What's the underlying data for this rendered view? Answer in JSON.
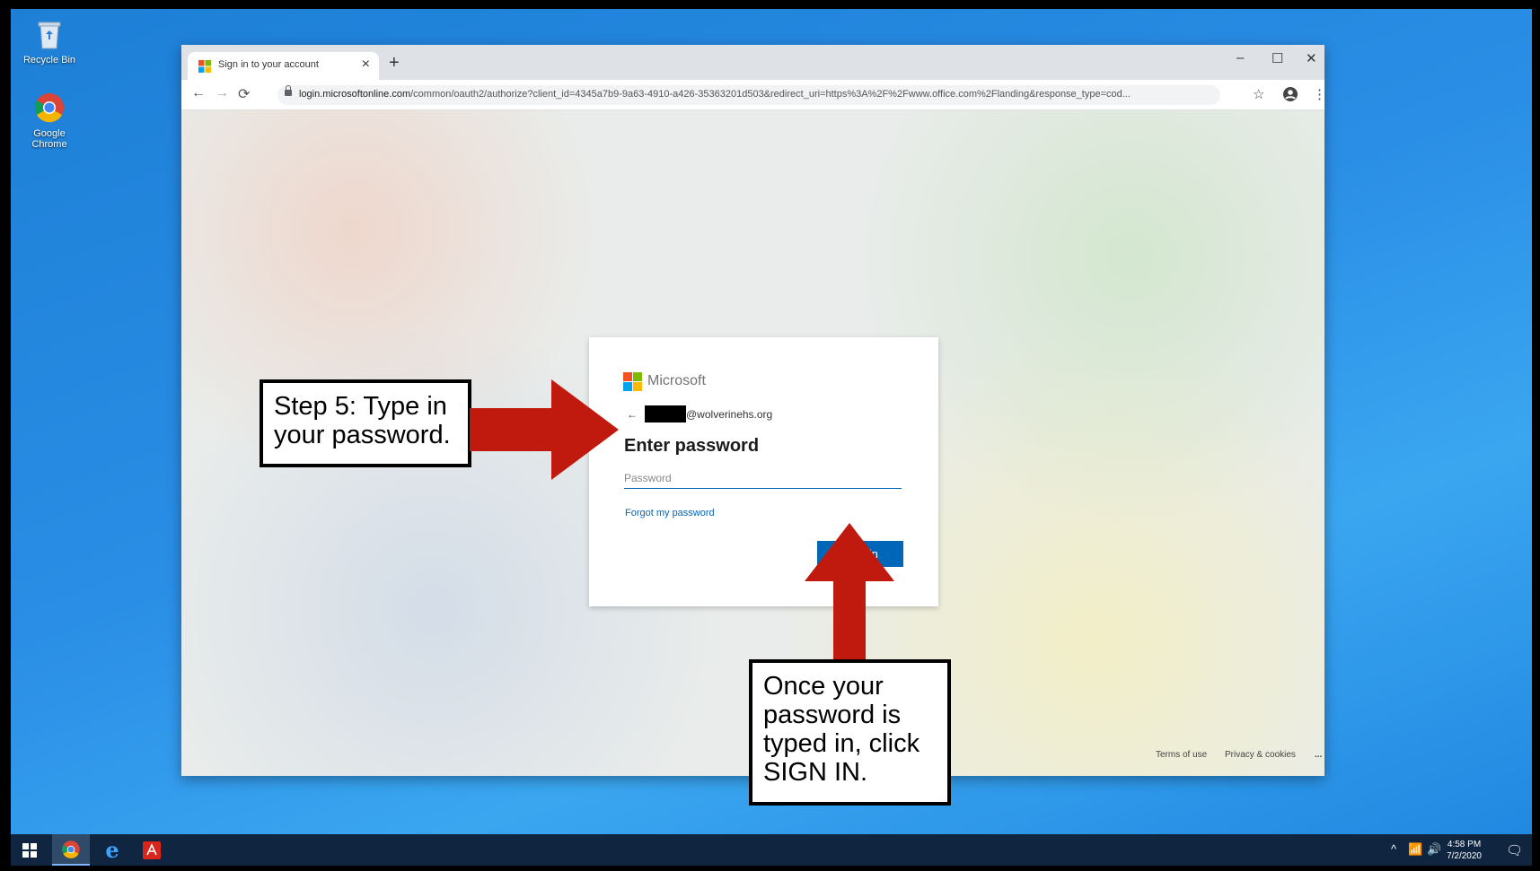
{
  "desktop": {
    "icons": [
      {
        "label": "Recycle Bin",
        "icon": "recycle-bin-icon"
      },
      {
        "label": "Google Chrome",
        "icon": "chrome-icon"
      }
    ]
  },
  "browser": {
    "tab_title": "Sign in to your account",
    "url_host": "login.microsoftonline.com",
    "url_rest": "/common/oauth2/authorize?client_id=4345a7b9-9a63-4910-a426-35363201d503&redirect_uri=https%3A%2F%2Fwww.office.com%2Flanding&response_type=cod..."
  },
  "signin": {
    "brand": "Microsoft",
    "account_domain": "@wolverinehs.org",
    "heading": "Enter password",
    "password_placeholder": "Password",
    "forgot_link": "Forgot my password",
    "submit_label": "Sign in",
    "footer_terms": "Terms of use",
    "footer_privacy": "Privacy & cookies",
    "footer_more": "..."
  },
  "annotations": {
    "step5": "Step 5: Type in your password.",
    "signin_hint": "Once your password is typed in, click SIGN IN.",
    "arrow_color": "#c0190d"
  },
  "taskbar": {
    "time": "4:58 PM",
    "date": "7/2/2020"
  }
}
